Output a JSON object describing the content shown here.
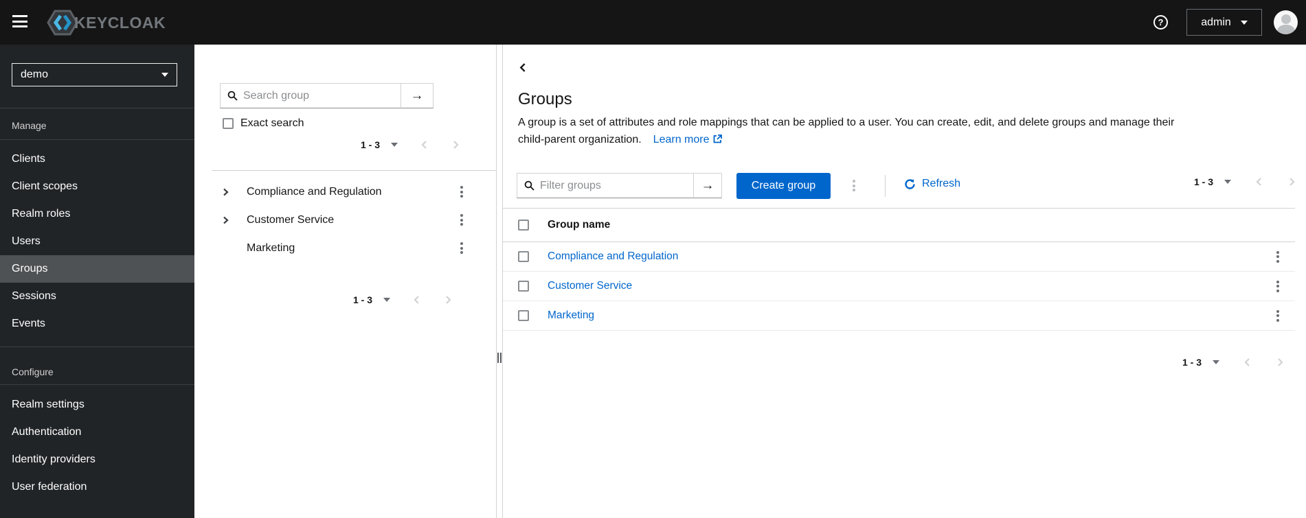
{
  "masthead": {
    "brand": "KEYCLOAK",
    "user_menu": {
      "label": "admin"
    }
  },
  "sidebar": {
    "realm_selector": {
      "value": "demo"
    },
    "sections": [
      {
        "label": "Manage",
        "items": [
          {
            "label": "Clients"
          },
          {
            "label": "Client scopes"
          },
          {
            "label": "Realm roles"
          },
          {
            "label": "Users"
          },
          {
            "label": "Groups",
            "active": true
          },
          {
            "label": "Sessions"
          },
          {
            "label": "Events"
          }
        ]
      },
      {
        "label": "Configure",
        "items": [
          {
            "label": "Realm settings"
          },
          {
            "label": "Authentication"
          },
          {
            "label": "Identity providers"
          },
          {
            "label": "User federation"
          }
        ]
      }
    ]
  },
  "tree_panel": {
    "search": {
      "placeholder": "Search group"
    },
    "exact_search_label": "Exact search",
    "pagination_top": {
      "range": "1 - 3"
    },
    "items": [
      {
        "label": "Compliance and Regulation",
        "expandable": true
      },
      {
        "label": "Customer Service",
        "expandable": true
      },
      {
        "label": "Marketing",
        "expandable": false
      }
    ],
    "pagination_bottom": {
      "range": "1 - 3"
    }
  },
  "main": {
    "title": "Groups",
    "description_line1": "A group is a set of attributes and role mappings that can be applied to a user. You can create, edit, and delete groups and manage their",
    "description_line2": "child-parent organization.",
    "learn_more_label": "Learn more",
    "toolbar": {
      "filter": {
        "placeholder": "Filter groups"
      },
      "create_button_label": "Create group",
      "refresh_label": "Refresh",
      "pagination": {
        "range": "1 - 3"
      }
    },
    "table": {
      "column_header": "Group name",
      "rows": [
        {
          "name": "Compliance and Regulation"
        },
        {
          "name": "Customer Service"
        },
        {
          "name": "Marketing"
        }
      ]
    },
    "pagination_bottom": {
      "range": "1 - 3"
    }
  },
  "icons": {
    "help": "?",
    "arrow_right": "→"
  },
  "colors": {
    "primary": "#0066cc",
    "link": "#0066cc",
    "masthead_bg": "#151515",
    "sidebar_bg": "#212427",
    "sidebar_active_bg": "#4f5255",
    "border": "#d2d2d2",
    "logo_cyan": "#4cb8e6"
  }
}
